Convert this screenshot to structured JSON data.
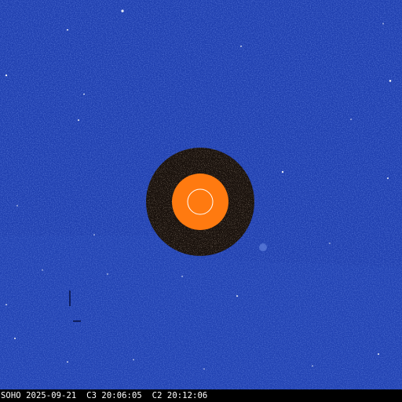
{
  "image": {
    "subject": "coronagraph composite",
    "colors": {
      "background_blue": "#1f3fb0",
      "occulter_dark": "#1a120d",
      "inner_disk_orange": "#ff7a10",
      "sun_outline": "#ffffff",
      "caption_bar": "#000000",
      "caption_text": "#ffffff"
    }
  },
  "caption": {
    "text": "SOHO 2025-09-21  C3 20:06:05  C2 20:12:06"
  }
}
